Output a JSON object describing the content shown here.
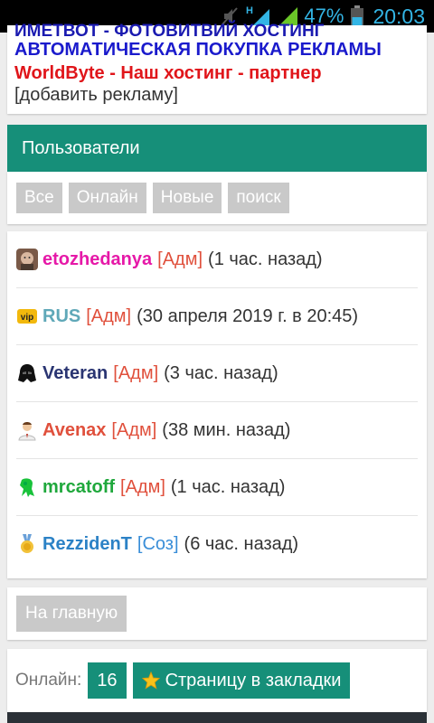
{
  "status_bar": {
    "network": "H",
    "battery": "47%",
    "time": "20:03",
    "icons": [
      "mute-icon",
      "signal-icon",
      "signal-icon",
      "battery-icon"
    ]
  },
  "ads": {
    "cut_line": "ИМЕТВОТ - ФОТОВИТВИЙ ХОСТИНГ",
    "items": [
      "АВТОМАТИЧЕСКАЯ ПОКУПКА РЕКЛАМЫ",
      "WorldByte - Наш хостинг - партнер",
      "[добавить рекламу]"
    ]
  },
  "users": {
    "title": "Пользователи",
    "tabs": [
      "Все",
      "Онлайн",
      "Новые",
      "поиск"
    ],
    "list": [
      {
        "nick": "etozhedanya",
        "role": "[Адм]",
        "when": "(1 час. назад)",
        "nick_color": "#e619a8",
        "role_color": "#e0503c",
        "icon": "avatar-face-icon"
      },
      {
        "nick": "RUS",
        "role": "[Адм]",
        "when": "(30 апреля 2019 г. в 20:45)",
        "nick_color": "#5fa8b8",
        "role_color": "#e0503c",
        "icon": "vip-icon"
      },
      {
        "nick": "Veteran",
        "role": "[Адм]",
        "when": "(3 час. назад)",
        "nick_color": "#2a3572",
        "role_color": "#e0503c",
        "icon": "vader-icon"
      },
      {
        "nick": "Avenax",
        "role": "[Адм]",
        "when": "(38 мин. назад)",
        "nick_color": "#e0503c",
        "role_color": "#e0503c",
        "icon": "man-icon"
      },
      {
        "nick": "mrcatoff",
        "role": "[Адм]",
        "when": "(1 час. назад)",
        "nick_color": "#1fa83c",
        "role_color": "#e0503c",
        "icon": "alien-icon"
      },
      {
        "nick": "RezzidenT",
        "role": "[Соз]",
        "when": "(6 час. назад)",
        "nick_color": "#2c82c6",
        "role_color": "#3a8ed8",
        "icon": "medal-icon"
      }
    ]
  },
  "home": {
    "label": "На главную"
  },
  "online": {
    "label": "Онлайн:",
    "count": "16",
    "bookmark_label": "Страницу в закладки"
  }
}
